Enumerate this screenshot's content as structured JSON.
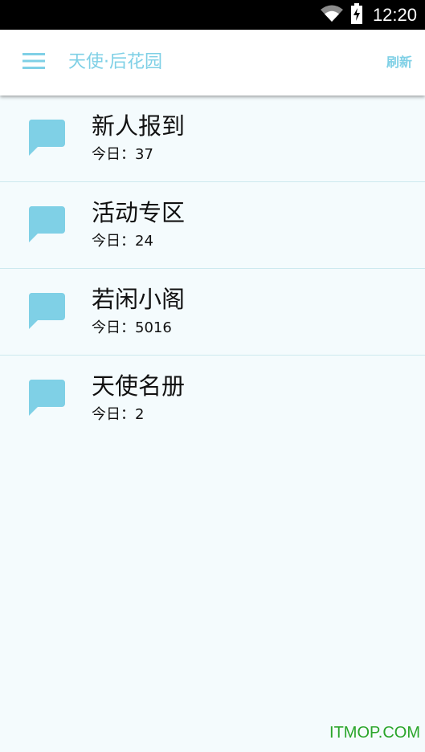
{
  "status_bar": {
    "time": "12:20",
    "icons": [
      "wifi-icon",
      "battery-icon"
    ]
  },
  "app_bar": {
    "menu_icon": "hamburger-menu-icon",
    "title": "天使·后花园",
    "refresh_label": "刷新"
  },
  "forums": [
    {
      "name": "新人报到",
      "today_label": "今日：",
      "today_count": "37",
      "icon": "chat-bubble-icon"
    },
    {
      "name": "活动专区",
      "today_label": "今日：",
      "today_count": "24",
      "icon": "chat-bubble-icon"
    },
    {
      "name": "若闲小阁",
      "today_label": "今日：",
      "today_count": "5016",
      "icon": "chat-bubble-icon"
    },
    {
      "name": "天使名册",
      "today_label": "今日：",
      "today_count": "2",
      "icon": "chat-bubble-icon"
    }
  ],
  "watermark": "ITMOP.COM",
  "colors": {
    "accent": "#7fd0e6",
    "background": "#f4fbfd",
    "divider": "#cde9ef",
    "status_bar": "#000000",
    "watermark": "#2aa52a"
  }
}
